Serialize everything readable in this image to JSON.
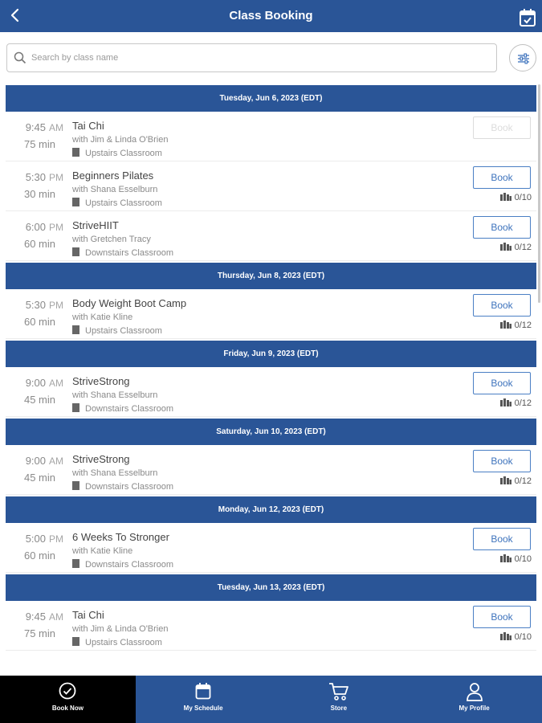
{
  "header": {
    "title": "Class Booking"
  },
  "search": {
    "placeholder": "Search by class name",
    "value": ""
  },
  "days": [
    {
      "label": "Tuesday, Jun 6, 2023 (EDT)",
      "classes": [
        {
          "time": "9:45",
          "ampm": "AM",
          "duration": "75 min",
          "name": "Tai Chi",
          "instructor": "with Jim & Linda O'Brien",
          "room": "Upstairs Classroom",
          "book": "Book",
          "capacity": "",
          "enabled": false
        },
        {
          "time": "5:30",
          "ampm": "PM",
          "duration": "30 min",
          "name": "Beginners Pilates",
          "instructor": "with Shana Esselburn",
          "room": "Upstairs Classroom",
          "book": "Book",
          "capacity": "0/10",
          "enabled": true
        },
        {
          "time": "6:00",
          "ampm": "PM",
          "duration": "60 min",
          "name": "StriveHIIT",
          "instructor": "with Gretchen Tracy",
          "room": "Downstairs Classroom",
          "book": "Book",
          "capacity": "0/12",
          "enabled": true
        }
      ]
    },
    {
      "label": "Thursday, Jun 8, 2023 (EDT)",
      "classes": [
        {
          "time": "5:30",
          "ampm": "PM",
          "duration": "60 min",
          "name": "Body Weight Boot Camp",
          "instructor": "with Katie Kline",
          "room": "Upstairs Classroom",
          "book": "Book",
          "capacity": "0/12",
          "enabled": true
        }
      ]
    },
    {
      "label": "Friday, Jun 9, 2023 (EDT)",
      "classes": [
        {
          "time": "9:00",
          "ampm": "AM",
          "duration": "45 min",
          "name": "StriveStrong",
          "instructor": "with Shana Esselburn",
          "room": "Downstairs Classroom",
          "book": "Book",
          "capacity": "0/12",
          "enabled": true
        }
      ]
    },
    {
      "label": "Saturday, Jun 10, 2023 (EDT)",
      "classes": [
        {
          "time": "9:00",
          "ampm": "AM",
          "duration": "45 min",
          "name": "StriveStrong",
          "instructor": "with Shana Esselburn",
          "room": "Downstairs Classroom",
          "book": "Book",
          "capacity": "0/12",
          "enabled": true
        }
      ]
    },
    {
      "label": "Monday, Jun 12, 2023 (EDT)",
      "classes": [
        {
          "time": "5:00",
          "ampm": "PM",
          "duration": "60 min",
          "name": "6 Weeks To Stronger",
          "instructor": "with Katie Kline",
          "room": "Downstairs Classroom",
          "book": "Book",
          "capacity": "0/10",
          "enabled": true
        }
      ]
    },
    {
      "label": "Tuesday, Jun 13, 2023 (EDT)",
      "classes": [
        {
          "time": "9:45",
          "ampm": "AM",
          "duration": "75 min",
          "name": "Tai Chi",
          "instructor": "with Jim & Linda O'Brien",
          "room": "Upstairs Classroom",
          "book": "Book",
          "capacity": "0/10",
          "enabled": true
        }
      ]
    }
  ],
  "nav": [
    {
      "label": "Book Now",
      "icon": "check-circle-icon",
      "active": true
    },
    {
      "label": "My Schedule",
      "icon": "calendar-icon",
      "active": false
    },
    {
      "label": "Store",
      "icon": "cart-icon",
      "active": false
    },
    {
      "label": "My Profile",
      "icon": "person-icon",
      "active": false
    }
  ],
  "colors": {
    "primary": "#2a5597",
    "accent": "#3f74bd",
    "active_tab": "#000000"
  }
}
